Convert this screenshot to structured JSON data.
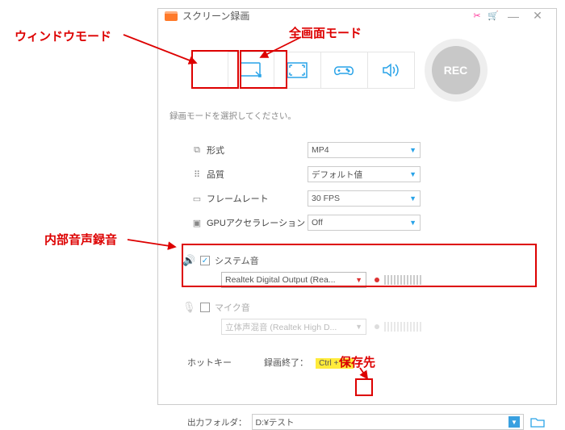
{
  "annotations": {
    "window_mode": "ウィンドウモード",
    "full_mode": "全画面モード",
    "internal_audio": "内部音声録音",
    "save_dest": "保存先"
  },
  "titlebar": {
    "title": "スクリーン録画",
    "minimize": "—",
    "close": "✕"
  },
  "modes": {
    "rec_label": "REC"
  },
  "hint": "録画モードを選択してください。",
  "settings": {
    "format_label": "形式",
    "format_value": "MP4",
    "quality_label": "品質",
    "quality_value": "デフォルト値",
    "fps_label": "フレームレート",
    "fps_value": "30 FPS",
    "gpu_label": "GPUアクセラレーション",
    "gpu_value": "Off"
  },
  "audio": {
    "system_label": "システム音",
    "system_device": "Realtek Digital Output (Rea...",
    "mic_label": "マイク音",
    "mic_device": "立体声混音 (Realtek High D...",
    "caret": "▼"
  },
  "hotkey": {
    "label": "ホットキー",
    "end_label": "録画終了：",
    "end_key": "Ctrl + F1"
  },
  "output": {
    "label": "出力フォルダ：",
    "path": "D:¥テスト",
    "caret": "▼"
  }
}
